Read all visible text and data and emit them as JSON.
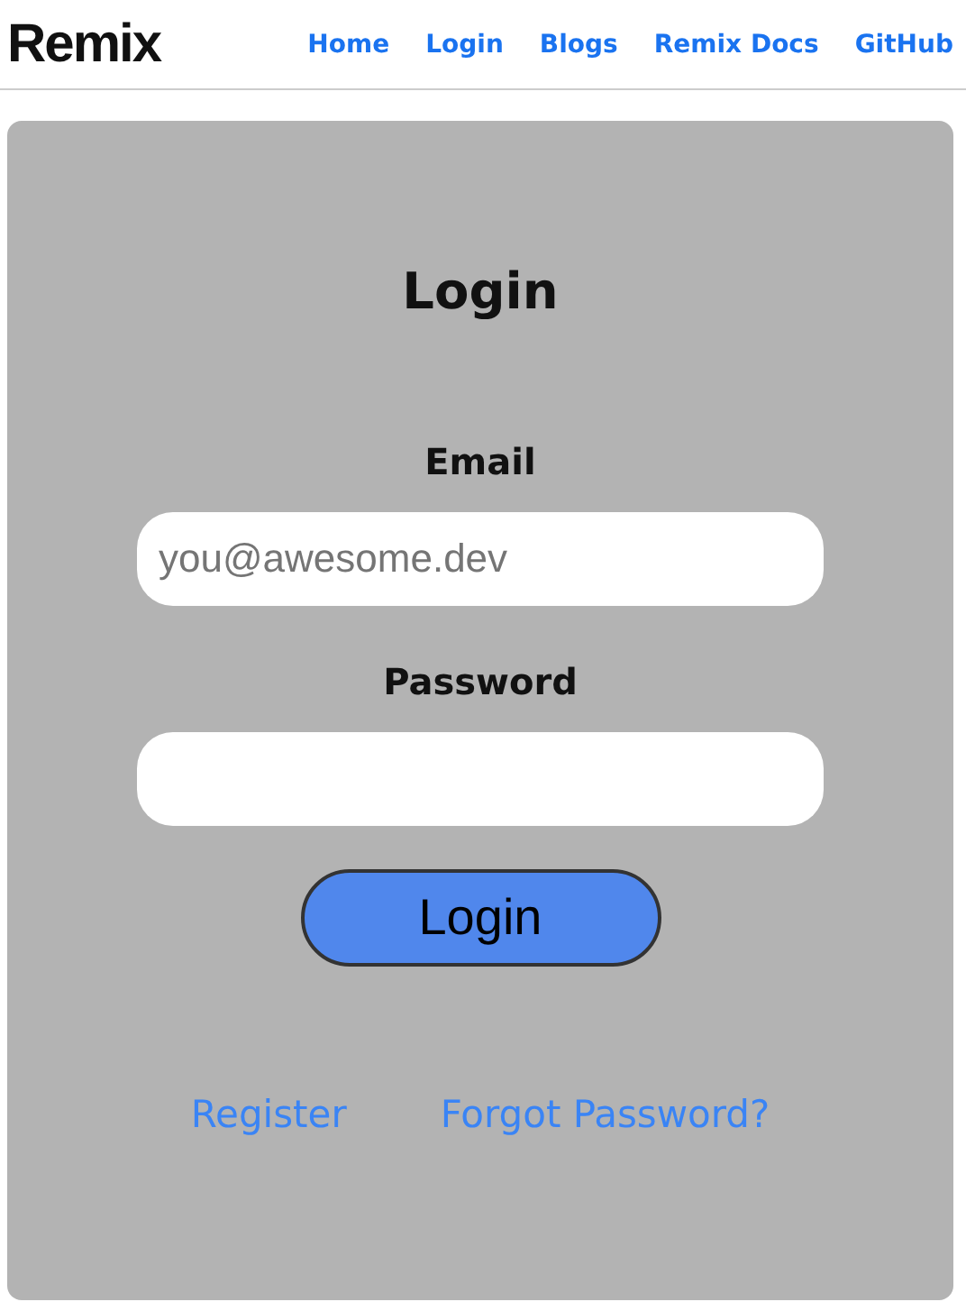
{
  "logo": "Remix",
  "nav": [
    {
      "label": "Home"
    },
    {
      "label": "Login"
    },
    {
      "label": "Blogs"
    },
    {
      "label": "Remix Docs"
    },
    {
      "label": "GitHub"
    }
  ],
  "form": {
    "title": "Login",
    "fields": [
      {
        "label": "Email",
        "placeholder": "you@awesome.dev"
      },
      {
        "label": "Password"
      }
    ],
    "submit": "Login"
  },
  "links": [
    {
      "label": "Register"
    },
    {
      "label": "Forgot Password?"
    }
  ]
}
